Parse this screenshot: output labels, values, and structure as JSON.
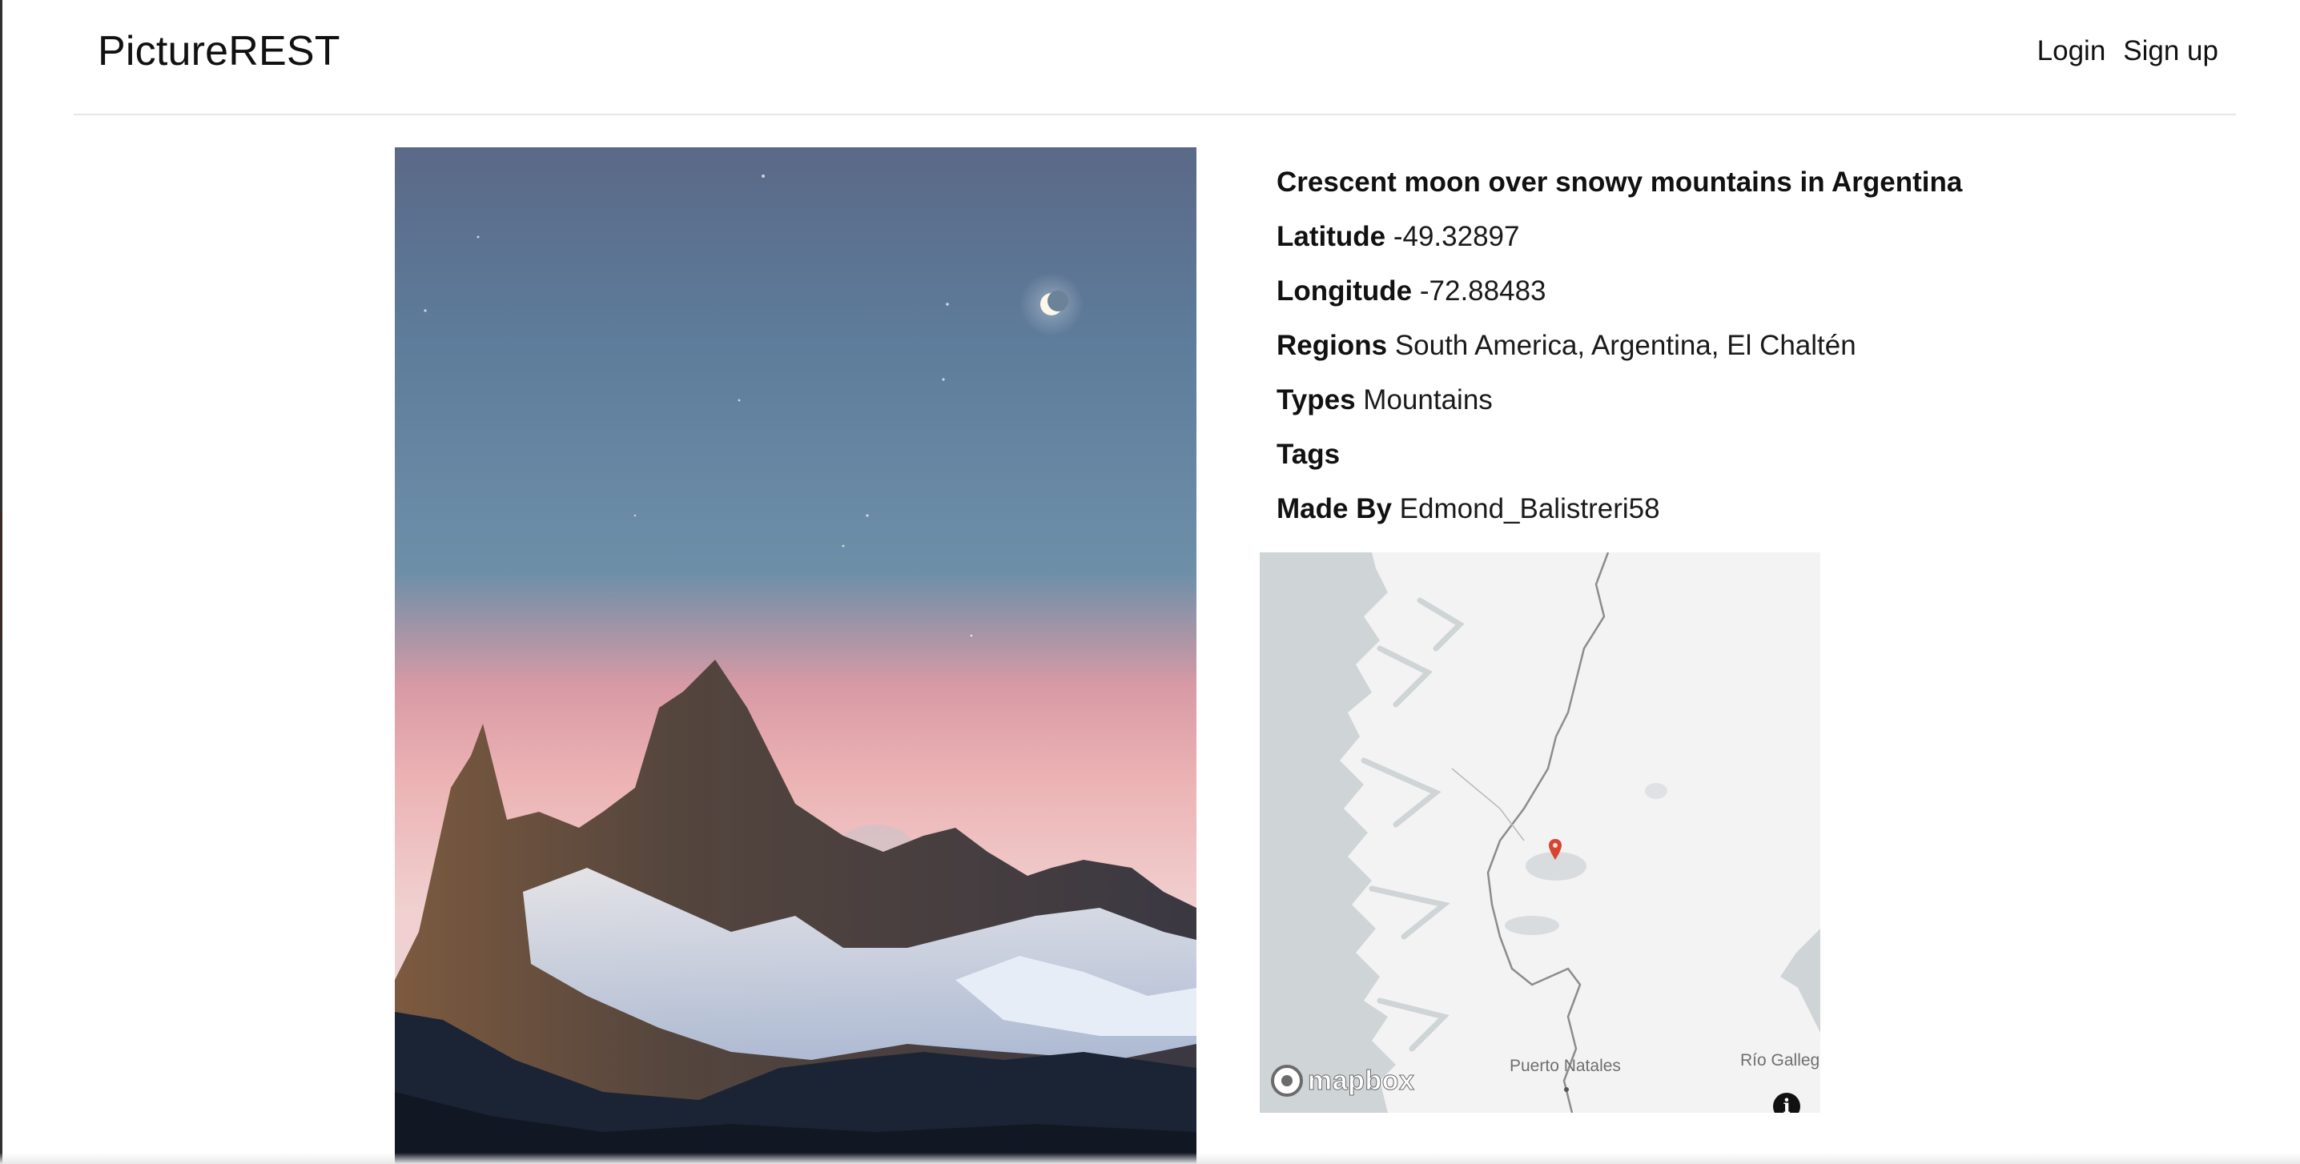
{
  "app": {
    "brand": "PictureREST"
  },
  "nav": {
    "login_label": "Login",
    "signup_label": "Sign up"
  },
  "photo": {
    "title": "Crescent moon over snowy mountains in Argentina"
  },
  "details": {
    "latitude_label": "Latitude",
    "latitude_value": "-49.32897",
    "longitude_label": "Longitude",
    "longitude_value": "-72.88483",
    "regions_label": "Regions",
    "regions_value": "South America, Argentina, El Chaltén",
    "types_label": "Types",
    "types_value": "Mountains",
    "tags_label": "Tags",
    "made_by_label": "Made By",
    "made_by_value": "Edmond_Balistreri58"
  },
  "map": {
    "logo_text": "mapbox",
    "labels": {
      "puerto_natales": "Puerto Natales",
      "rio_gallegos": "Río Galleg"
    },
    "info_glyph": "i",
    "marker_color": "#d64532",
    "water_color": "#cfd4d6",
    "land_color": "#f3f3f3"
  },
  "icons": {
    "map_marker": "map-marker-icon",
    "info": "info-icon",
    "mapbox_logo": "mapbox-logo-icon"
  }
}
